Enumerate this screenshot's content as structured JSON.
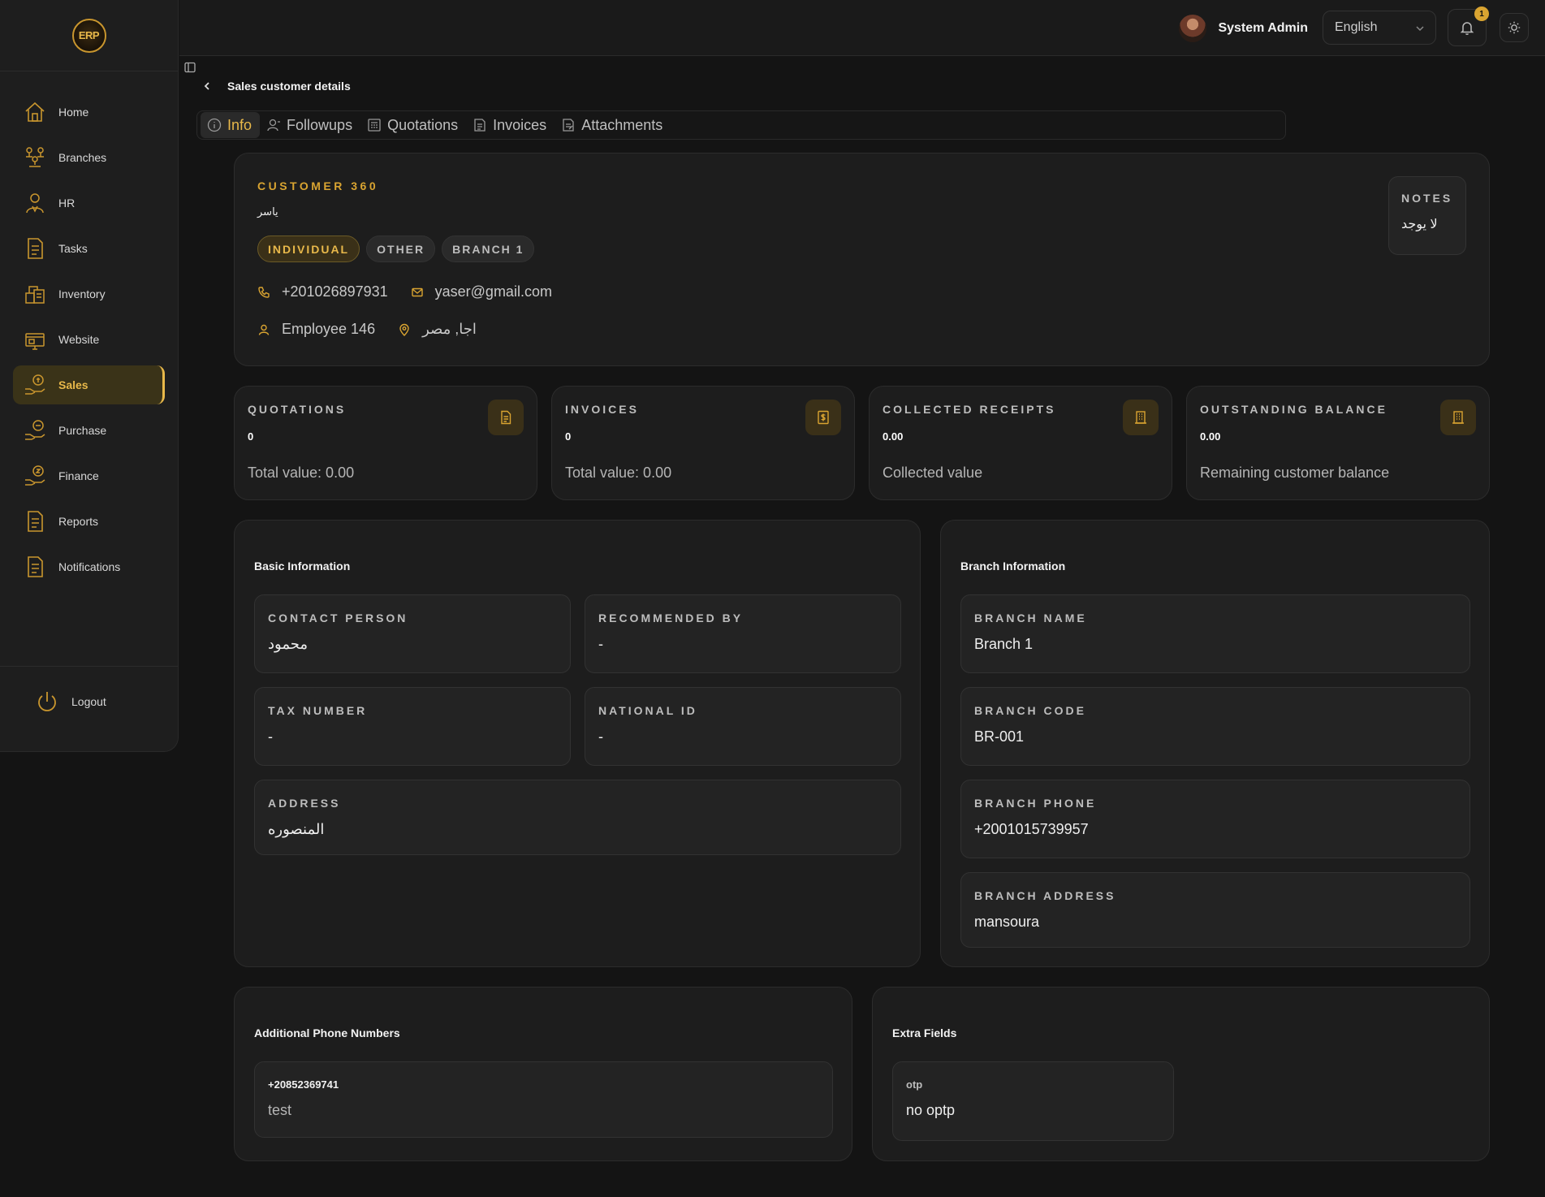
{
  "app": {
    "logo_text": "ERP"
  },
  "sidebar": {
    "items": [
      {
        "label": "Home",
        "icon": "home-icon"
      },
      {
        "label": "Branches",
        "icon": "branches-icon"
      },
      {
        "label": "HR",
        "icon": "hr-icon"
      },
      {
        "label": "Tasks",
        "icon": "document-icon"
      },
      {
        "label": "Inventory",
        "icon": "inventory-icon"
      },
      {
        "label": "Website",
        "icon": "website-icon"
      },
      {
        "label": "Sales",
        "icon": "sales-icon",
        "active": true
      },
      {
        "label": "Purchase",
        "icon": "purchase-icon"
      },
      {
        "label": "Finance",
        "icon": "finance-icon"
      },
      {
        "label": "Reports",
        "icon": "document-icon"
      },
      {
        "label": "Notifications",
        "icon": "document-icon"
      }
    ],
    "logout_label": "Logout"
  },
  "topbar": {
    "user_name": "System Admin",
    "language": "English",
    "notification_count": "1"
  },
  "page": {
    "title": "Sales customer details",
    "tabs": [
      {
        "label": "Info",
        "active": true
      },
      {
        "label": "Followups"
      },
      {
        "label": "Quotations"
      },
      {
        "label": "Invoices"
      },
      {
        "label": "Attachments"
      }
    ]
  },
  "customer": {
    "eyebrow": "CUSTOMER 360",
    "name": "ياسر",
    "chips": [
      "INDIVIDUAL",
      "OTHER",
      "BRANCH 1"
    ],
    "phone": "+201026897931",
    "email": "yaser@gmail.com",
    "employee": "Employee 146",
    "location": "اجا, مصر",
    "notes_label": "NOTES",
    "notes_value": "لا يوجد"
  },
  "stats": [
    {
      "label": "QUOTATIONS",
      "value": "0",
      "sub": "Total value: 0.00",
      "icon": "document-icon"
    },
    {
      "label": "INVOICES",
      "value": "0",
      "sub": "Total value: 0.00",
      "icon": "dollar-receipt-icon"
    },
    {
      "label": "COLLECTED RECEIPTS",
      "value": "0.00",
      "sub": "Collected value",
      "icon": "building-icon"
    },
    {
      "label": "OUTSTANDING BALANCE",
      "value": "0.00",
      "sub": "Remaining customer balance",
      "icon": "building-icon"
    }
  ],
  "basic_info": {
    "title": "Basic Information",
    "contact_person": {
      "label": "CONTACT PERSON",
      "value": "محمود"
    },
    "recommended_by": {
      "label": "RECOMMENDED BY",
      "value": "-"
    },
    "tax_number": {
      "label": "TAX NUMBER",
      "value": "-"
    },
    "national_id": {
      "label": "NATIONAL ID",
      "value": "-"
    },
    "address": {
      "label": "ADDRESS",
      "value": "المنصوره"
    }
  },
  "branch_info": {
    "title": "Branch Information",
    "name": {
      "label": "BRANCH NAME",
      "value": "Branch 1"
    },
    "code": {
      "label": "BRANCH CODE",
      "value": "BR-001"
    },
    "phone": {
      "label": "BRANCH PHONE",
      "value": "+2001015739957"
    },
    "address": {
      "label": "BRANCH ADDRESS",
      "value": "mansoura"
    }
  },
  "additional_phones": {
    "title": "Additional Phone Numbers",
    "items": [
      {
        "number": "+20852369741",
        "note": "test"
      }
    ]
  },
  "extra_fields": {
    "title": "Extra Fields",
    "items": [
      {
        "key": "otp",
        "value": "no optp"
      }
    ]
  },
  "colors": {
    "accent": "#d9a431",
    "background": "#141414",
    "card": "#1d1d1d"
  }
}
